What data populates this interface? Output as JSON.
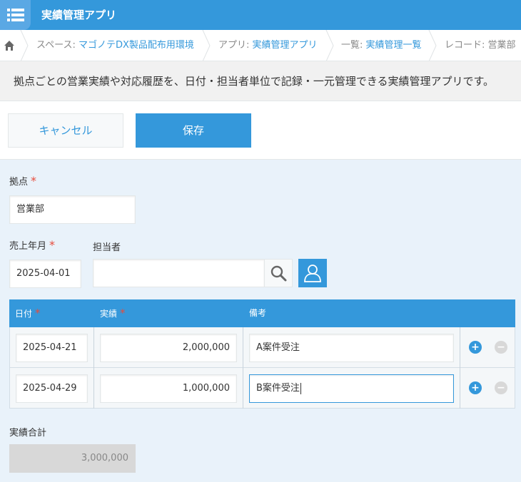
{
  "header": {
    "app_title": "実績管理アプリ"
  },
  "breadcrumb": {
    "space_prefix": "スペース: ",
    "space_value": "マゴノテDX製品配布用環境",
    "app_prefix": "アプリ: ",
    "app_value": "実績管理アプリ",
    "list_prefix": "一覧: ",
    "list_value": "実績管理一覧",
    "record_prefix": "レコード: ",
    "record_value": "営業部"
  },
  "description": "拠点ごとの営業実績や対応履歴を、日付・担当者単位で記録・一元管理できる実績管理アプリです。",
  "toolbar": {
    "cancel_label": "キャンセル",
    "save_label": "保存"
  },
  "form": {
    "base": {
      "label": "拠点",
      "required_mark": "*",
      "value": "営業部"
    },
    "sales_month": {
      "label": "売上年月",
      "required_mark": "*",
      "value": "2025-04-01"
    },
    "assignee": {
      "label": "担当者",
      "value": ""
    },
    "table": {
      "headers": {
        "date": "日付",
        "date_required": "*",
        "result": "実績",
        "result_required": "*",
        "note": "備考"
      },
      "rows": [
        {
          "date": "2025-04-21",
          "result": "2,000,000",
          "note": "A案件受注"
        },
        {
          "date": "2025-04-29",
          "result": "1,000,000",
          "note": "B案件受注"
        }
      ],
      "add_symbol": "+",
      "remove_symbol": "−"
    },
    "total": {
      "label": "実績合計",
      "value": "3,000,000"
    }
  },
  "icons": {
    "menu": "menu-icon",
    "home": "home-icon",
    "search": "search-icon",
    "user": "user-icon",
    "add": "add-row-icon",
    "remove": "remove-row-icon"
  },
  "colors": {
    "accent": "#3498db",
    "required": "#e74c3c",
    "background": "#e9f2fa"
  }
}
